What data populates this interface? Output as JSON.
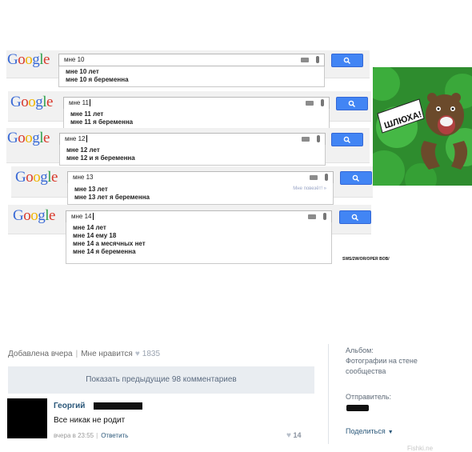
{
  "google_logo": [
    "G",
    "o",
    "o",
    "g",
    "l",
    "e"
  ],
  "searches": [
    {
      "query": "мне 10",
      "suggestions": [
        "мне 10 лет",
        "мне 10 я беременна"
      ],
      "extra": ""
    },
    {
      "query": "мне 11",
      "suggestions": [
        "мне 11 лет",
        "мне 11 я беременна"
      ],
      "extra": ""
    },
    {
      "query": "мне 12",
      "suggestions": [
        "мне 12 лет",
        "мне 12 и я беременна"
      ],
      "extra": ""
    },
    {
      "query": "мне 13",
      "suggestions": [
        "мне 13 лет",
        "мне 13 лет я беременна"
      ],
      "extra": "Мне повезёт! »"
    },
    {
      "query": "мне 14",
      "suggestions": [
        "мне 14 лет",
        "мне 14 ему 18",
        "мне 14 а месячных нет",
        "мне 14 я беременна"
      ],
      "extra": ""
    }
  ],
  "bear_image": {
    "speech": "ШЛЮХА!",
    "colors": {
      "bg": "#2e8c2e",
      "bush": "#3cad3c",
      "bear": "#6b4a2b",
      "bubble": "#ffffff"
    }
  },
  "credit": "SWS/2W/OR/OPER BOB/",
  "post": {
    "added": "Добавлена вчера",
    "like_label": "Мне нравится",
    "likes": "1835",
    "show_more": "Показать предыдущие 98 комментариев"
  },
  "comment": {
    "author": "Георгий",
    "text": "Все никак не родит",
    "date": "вчера в 23:55",
    "reply": "Ответить",
    "likes": "14"
  },
  "sidebar": {
    "album_label": "Альбом:",
    "album_name": "Фотографии на стене сообщества",
    "sender_label": "Отправитель:",
    "share": "Поделиться"
  },
  "truncated_text": "Fishki.ne"
}
